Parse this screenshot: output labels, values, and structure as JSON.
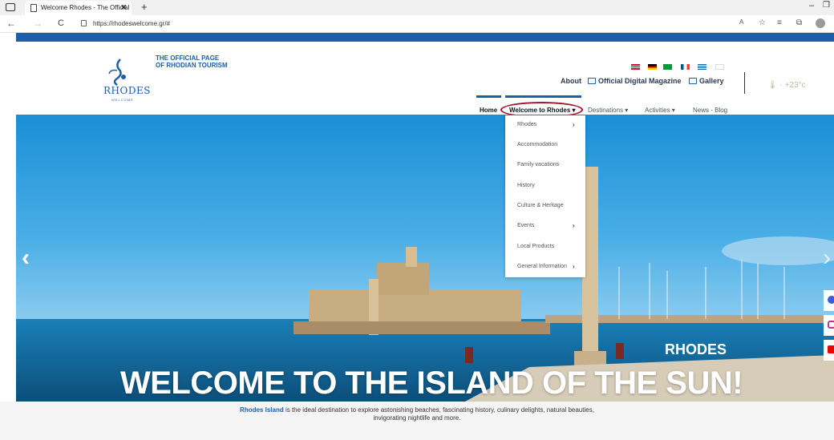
{
  "browser": {
    "tab_title": "Welcome Rhodes - The Official P",
    "tab_close": "✕",
    "new_tab": "+",
    "url": "https://rhodeswelcome.gr/#",
    "back": "←",
    "forward": "→",
    "reload": "C",
    "minimize": "–",
    "maximize": "❐"
  },
  "site": {
    "tagline_line1": "THE OFFICIAL PAGE",
    "tagline_line2": "OF RHODIAN TOURISM",
    "logo_text": "RHODES",
    "logo_sub": "WELCOME",
    "top_links": {
      "about": "About",
      "magazine": "Official Digital Magazine",
      "gallery": "Gallery"
    },
    "weather": "🌡 · +23°c",
    "flags": [
      "uk-flag",
      "de-flag",
      "br-flag",
      "fr-flag",
      "gr-flag",
      "kr-flag"
    ],
    "nav": {
      "home": "Home",
      "welcome": "Welcome to Rhodes",
      "destinations": "Destinations",
      "activities": "Activities",
      "news": "News - Blog",
      "chevron": "▾"
    },
    "dropdown": [
      {
        "label": "Rhodes",
        "has_sub": true
      },
      {
        "label": "Accommodation",
        "has_sub": false
      },
      {
        "label": "Family vacations",
        "has_sub": false
      },
      {
        "label": "History",
        "has_sub": false
      },
      {
        "label": "Culture & Heritage",
        "has_sub": false
      },
      {
        "label": "Events",
        "has_sub": true
      },
      {
        "label": "Local Products",
        "has_sub": false
      },
      {
        "label": "General Information",
        "has_sub": true
      }
    ],
    "dropdown_chevron": "›",
    "hero": {
      "caption": "RHODES",
      "title": "WELCOME TO THE ISLAND OF THE SUN!",
      "prev": "‹",
      "next": "›"
    },
    "intro": {
      "strong": "Rhodes Island",
      "line1_rest": " is the ideal destination to explore astonishing beaches, fascinating history, culinary delights, natural beauties,",
      "line2": "invigorating nightlife and more."
    }
  },
  "colors": {
    "brand_blue": "#1f5fa8",
    "highlight_circle": "#a3162a"
  }
}
